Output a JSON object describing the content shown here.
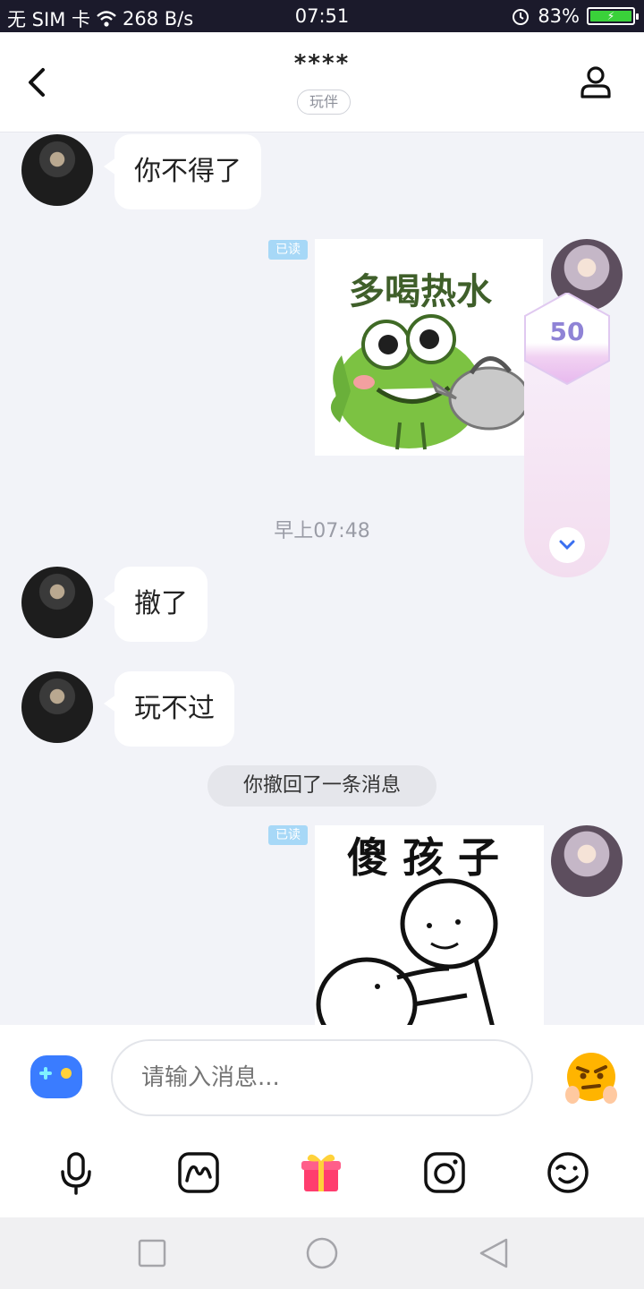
{
  "status": {
    "carrier": "无 SIM 卡",
    "speed": "268 B/s",
    "time": "07:51",
    "battery": "83%"
  },
  "header": {
    "title": "****",
    "tag": "玩伴"
  },
  "messages": {
    "m1": "你不得了",
    "read1": "已读",
    "sticker1": "多喝热水",
    "time_divider": "早上07:48",
    "m2": "撤了",
    "m3": "玩不过",
    "system": "你撤回了一条消息",
    "read2": "已读",
    "sticker2": "傻 孩 子"
  },
  "badge": {
    "value": "50"
  },
  "input": {
    "placeholder": "请输入消息..."
  },
  "colors": {
    "accent": "#6f6fd8",
    "read_tag": "#a7d8f7",
    "gift": "#ff3d6e"
  }
}
